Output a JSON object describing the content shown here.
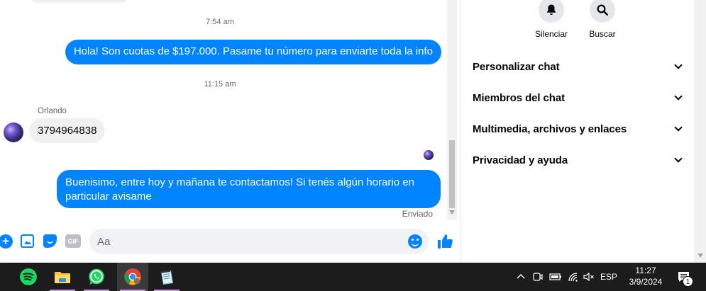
{
  "chat": {
    "time_1": "7:54 am",
    "message_out_1": "Hola! Son cuotas de $197.000. Pasame tu número para enviarte toda la info",
    "time_2": "11:15 am",
    "sender_name": "Orlando",
    "message_in_1": "3794964838",
    "message_out_2": "Buenisimo, entre hoy y mañana te contactamos! Si tenés algún horario en particular avisame",
    "status": "Enviado"
  },
  "composer": {
    "placeholder": "Aa",
    "gif_label": "GIF",
    "icons": [
      "plus-icon",
      "image-icon",
      "sticker-icon",
      "gif-icon",
      "emoji-icon",
      "like-icon"
    ]
  },
  "details": {
    "actions": [
      {
        "label": "Silenciar",
        "icon": "bell-icon"
      },
      {
        "label": "Buscar",
        "icon": "search-icon"
      }
    ],
    "sections": [
      "Personalizar chat",
      "Miembros del chat",
      "Multimedia, archivos y enlaces",
      "Privacidad y ayuda"
    ]
  },
  "taskbar": {
    "apps": [
      "spotify",
      "file-explorer",
      "whatsapp",
      "chrome",
      "notepad"
    ],
    "language": "ESP",
    "time": "11:27",
    "date": "3/9/2024",
    "notification_count": "1"
  },
  "colors": {
    "accent": "#0084ff",
    "incoming_bubble": "#f0f0f0",
    "taskbar": "#1c1c1c"
  }
}
